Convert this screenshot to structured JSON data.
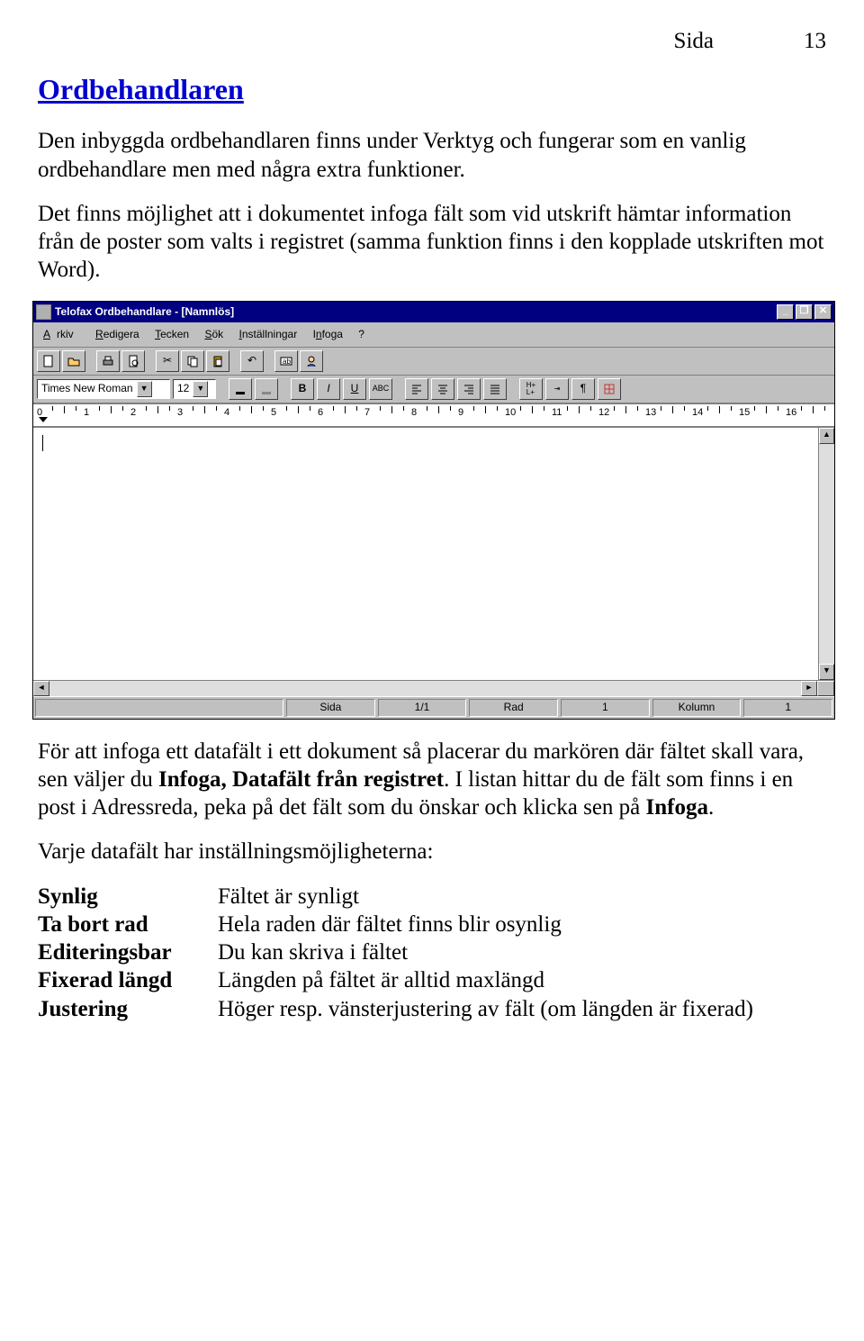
{
  "header": {
    "left": "",
    "page_label": "Sida",
    "page_num": "13"
  },
  "title": "Ordbehandlaren",
  "para1": "Den inbyggda ordbehandlaren finns under Verktyg och fungerar som en vanlig ordbehandlare men med några extra funktioner.",
  "para2": "Det finns möjlighet att i dokumentet infoga fält som vid utskrift hämtar information från de poster som valts i registret (samma funktion finns i den kopplade utskriften mot Word).",
  "screenshot": {
    "title": "Telofax Ordbehandlare - [Namnlös]",
    "menus": [
      "Arkiv",
      "Redigera",
      "Tecken",
      "Sök",
      "Inställningar",
      "Infoga",
      "?"
    ],
    "font_name": "Times New Roman",
    "font_size": "12",
    "ruler_numbers": [
      "0",
      "1",
      "2",
      "3",
      "4",
      "5",
      "6",
      "7",
      "8",
      "9",
      "10",
      "11",
      "12",
      "13",
      "14",
      "15",
      "16"
    ],
    "status": {
      "sida_label": "Sida",
      "sida_val": "1/1",
      "rad_label": "Rad",
      "rad_val": "1",
      "kol_label": "Kolumn",
      "kol_val": "1"
    }
  },
  "para3_a": "För att infoga ett datafält i ett dokument så placerar du markören där fältet skall vara, sen väljer du ",
  "para3_b": "Infoga, Datafält från registret",
  "para3_c": ". I listan hittar du de fält som finns i en post i Adressreda, peka på det fält som du önskar och klicka sen på ",
  "para3_d": "Infoga",
  "para3_e": ".",
  "para4": "Varje datafält har inställningsmöjligheterna:",
  "defs": [
    {
      "term": "Synlig",
      "desc": "Fältet är synligt"
    },
    {
      "term": "Ta bort rad",
      "desc": "Hela raden där fältet finns blir osynlig"
    },
    {
      "term": "Editeringsbar",
      "desc": "Du kan skriva i fältet"
    },
    {
      "term": "Fixerad längd",
      "desc": "Längden på fältet är alltid maxlängd"
    },
    {
      "term": "Justering",
      "desc": "Höger resp. vänsterjustering av fält (om längden är fixerad)"
    }
  ]
}
